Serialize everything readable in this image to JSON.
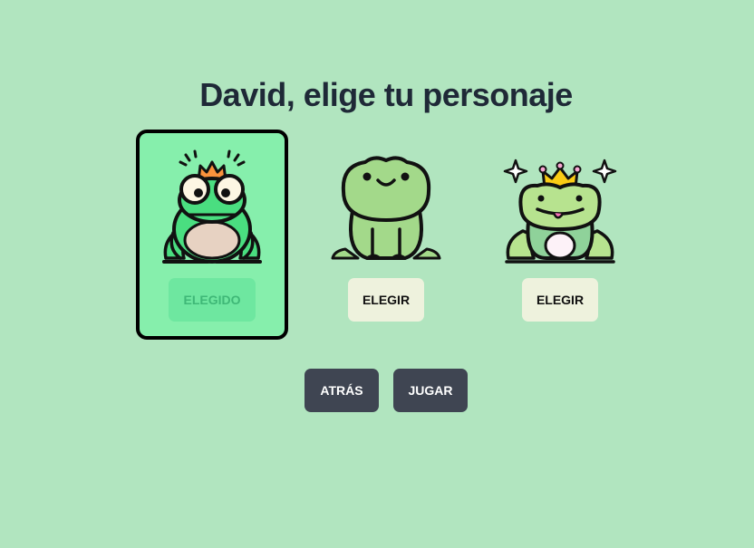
{
  "page": {
    "title": "David, elige tu personaje"
  },
  "characters": [
    {
      "name": "frog-prince-1",
      "button_label": "ELEGIDO",
      "selected": true
    },
    {
      "name": "frog-smile",
      "button_label": "ELEGIR",
      "selected": false
    },
    {
      "name": "frog-prince-2",
      "button_label": "ELEGIR",
      "selected": false
    }
  ],
  "nav": {
    "back_label": "ATRÁS",
    "play_label": "JUGAR"
  },
  "colors": {
    "background": "#b1e5bf",
    "selected_card": "#86efac",
    "choose_button": "#eef2dd",
    "nav_button": "#3f4552",
    "title_text": "#1f2937"
  },
  "icons": [
    "frog-with-crown-icon",
    "smiling-frog-icon",
    "frog-with-crown-and-sparkles-icon"
  ]
}
